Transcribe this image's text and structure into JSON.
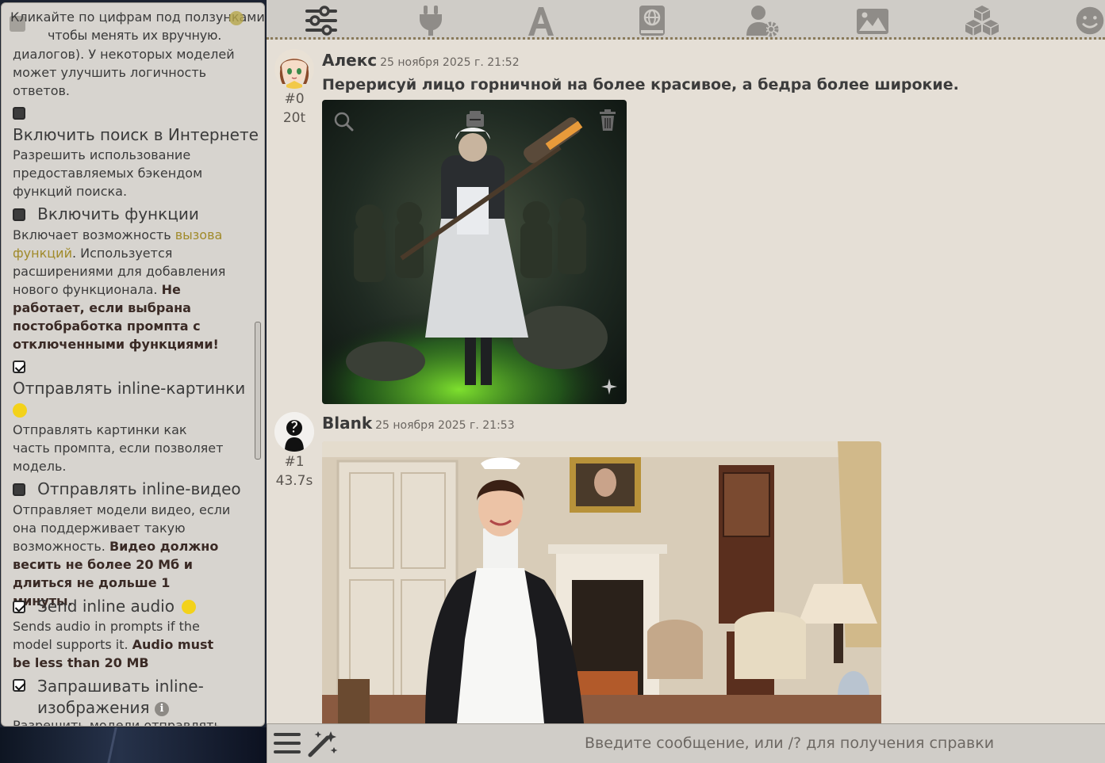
{
  "left_panel": {
    "top_line_1": "Кликайте по цифрам под ползунками,",
    "top_line_2": "чтобы менять их вручную.",
    "prev_desc": "диалогов). У некоторых моделей может улучшить логичность ответов.",
    "web_search": {
      "checked": false,
      "title": "Включить поиск в Интернете",
      "desc": "Разрешить использование предоставляемых бэкендом функций поиска."
    },
    "functions": {
      "checked": false,
      "title": "Включить функции",
      "desc_1": "Включает возможность ",
      "desc_link": "вызова функций",
      "desc_2": ". Используется расширениями для добавления нового функционала. ",
      "desc_bold": "Не работает, если выбрана постобработка промпта с отключенными функциями!"
    },
    "inline_images": {
      "checked": true,
      "title": "Отправлять inline-картинки",
      "desc": "Отправлять картинки как часть промпта, если позволяет модель."
    },
    "inline_video": {
      "checked": false,
      "title": "Отправлять inline-видео",
      "desc": "Отправляет модели видео, если она поддерживает такую возможность. ",
      "desc_bold": "Видео должно весить не более 20 Мб и длиться не дольше 1 минуты."
    },
    "inline_audio": {
      "checked": true,
      "title": "Send inline audio",
      "desc": "Sends audio in prompts if the model supports it. ",
      "desc_bold": "Audio must be less than 20 MB"
    },
    "request_images": {
      "checked": true,
      "title": "Запрашивать inline-изображения",
      "info": "i",
      "desc": "Разрешить модели отправлять"
    }
  },
  "topbar": {
    "icons": [
      "sliders-icon",
      "plug-icon",
      "font-icon",
      "book-globe-icon",
      "user-cog-icon",
      "image-icon",
      "cubes-icon",
      "smile-icon"
    ]
  },
  "messages": [
    {
      "name": "Алекс",
      "time": "25 ноября 2025 г. 21:52",
      "id": "#0",
      "stat": "20t",
      "text": "Перерисуй лицо горничной на более красивое, а бедра более широкие."
    },
    {
      "name": "Blank",
      "time": "25 ноября 2025 г. 21:53",
      "id": "#1",
      "stat": "43.7s",
      "text": ""
    }
  ],
  "bottombar": {
    "placeholder": "Введите сообщение, или /? для получения справки"
  },
  "colors": {
    "accent_link": "#a08a2a",
    "hint_dot": "#f3d21a",
    "chat_bg": "#e5dfd6",
    "panel_bg": "#d7d4cf"
  }
}
